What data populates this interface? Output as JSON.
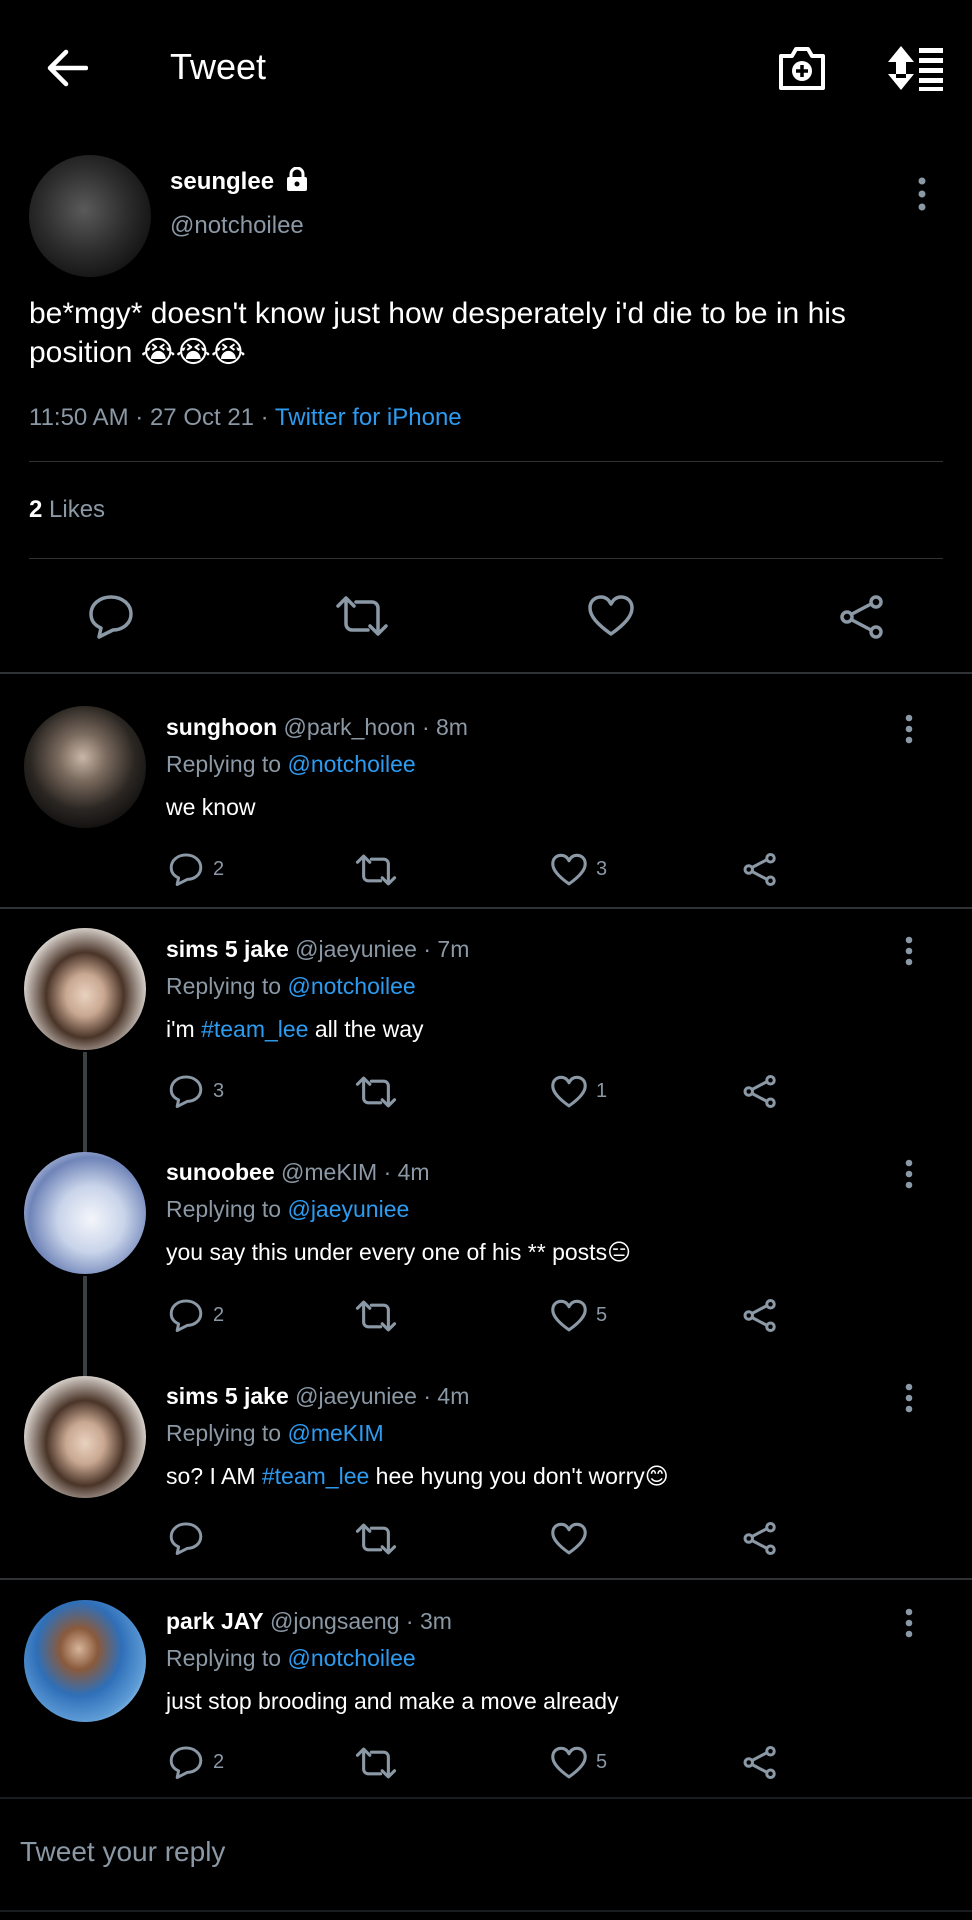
{
  "header": {
    "title": "Tweet"
  },
  "tweet": {
    "name": "seunglee",
    "handle": "@notchoilee",
    "text": "be*mgy* doesn't know just how desperately i'd die to be in his position 😭😭😭",
    "time": "11:50 AM · 27 Oct 21 · ",
    "source": "Twitter for iPhone",
    "likes_count": "2",
    "likes_label": " Likes"
  },
  "replies": [
    {
      "name": "sunghoon",
      "meta": " @park_hoon · 8m",
      "replying_label": "Replying to ",
      "replying_to": "@notchoilee",
      "text": "we know",
      "reply_count": "2",
      "like_count": "3"
    },
    {
      "name": "sims 5 jake",
      "meta": " @jaeyuniee · 7m",
      "replying_label": "Replying to ",
      "replying_to": "@notchoilee",
      "text_pre": "i'm ",
      "hashtag": "#team_lee",
      "text_post": " all the way",
      "reply_count": "3",
      "like_count": "1"
    },
    {
      "name": "sunoobee",
      "meta": " @meKIM · 4m",
      "replying_label": "Replying to ",
      "replying_to": "@jaeyuniee",
      "text": "you say this under every one of his ** posts😑",
      "reply_count": "2",
      "like_count": "5"
    },
    {
      "name": "sims 5 jake",
      "meta": " @jaeyuniee · 4m",
      "replying_label": "Replying to ",
      "replying_to": "@meKIM",
      "text_pre": "so? I AM ",
      "hashtag": "#team_lee",
      "text_post": " hee hyung you don't worry😊",
      "reply_count": "",
      "like_count": ""
    },
    {
      "name": "park JAY",
      "meta": " @jongsaeng · 3m",
      "replying_label": "Replying to ",
      "replying_to": "@notchoilee",
      "text": "just stop brooding and make a move already",
      "reply_count": "2",
      "like_count": "5"
    }
  ],
  "reply_input": {
    "placeholder": "Tweet your reply"
  },
  "colors": {
    "background": "#000000",
    "link": "#2d9bf0",
    "secondary_text": "#8b98a5",
    "divider": "#2f3336"
  },
  "icons": [
    "back-arrow-icon",
    "camera-add-icon",
    "sort-icon",
    "lock-icon",
    "more-vertical-icon",
    "reply-icon",
    "retweet-icon",
    "like-icon",
    "share-icon"
  ]
}
